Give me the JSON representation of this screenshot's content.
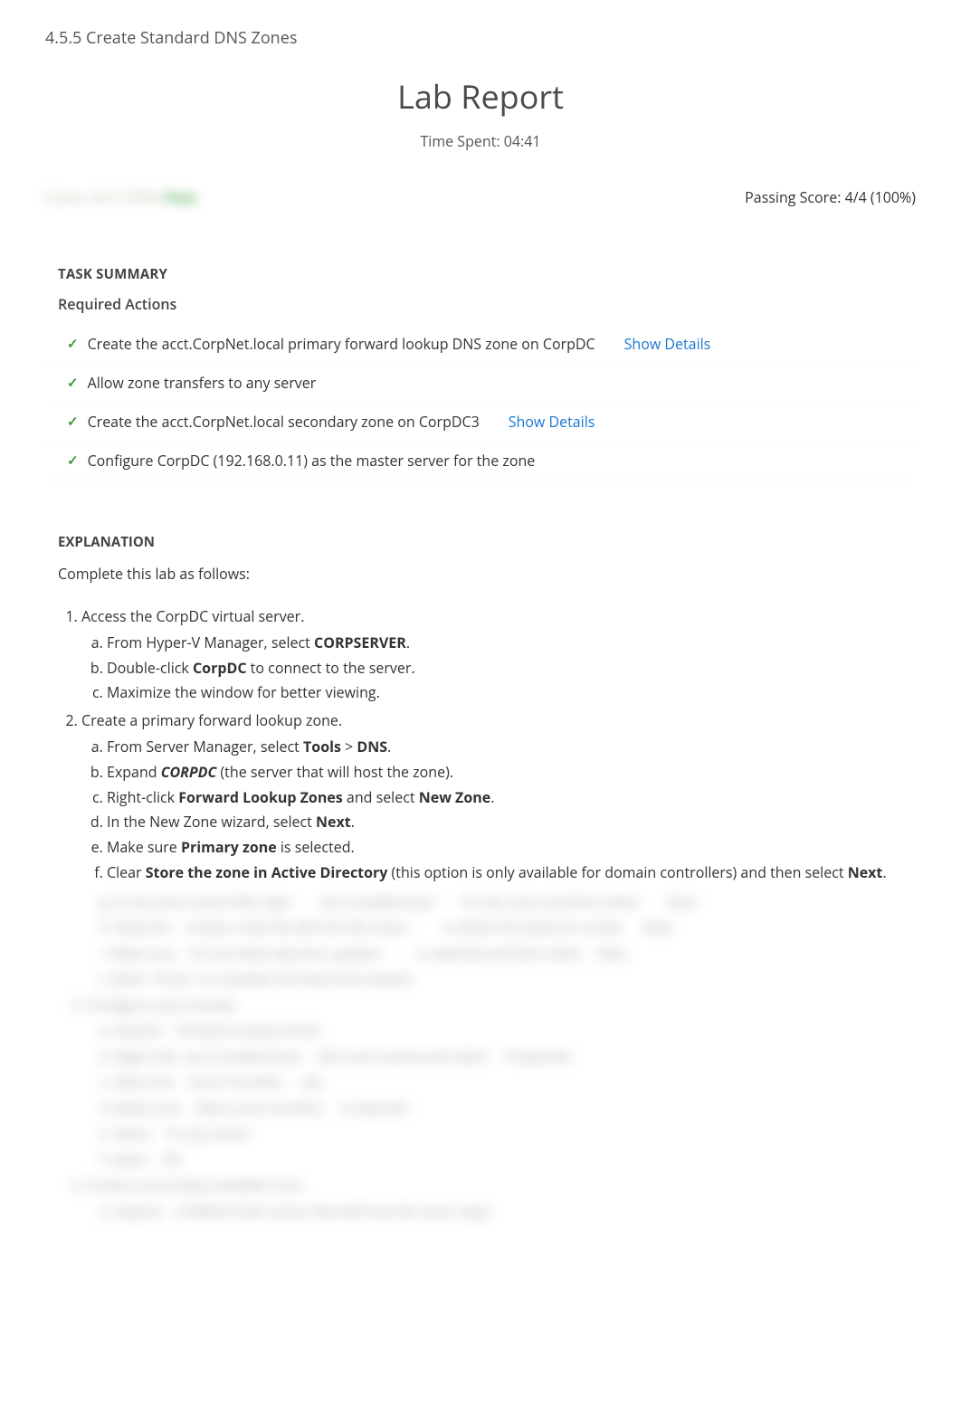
{
  "breadcrumb": "4.5.5 Create Standard DNS Zones",
  "report": {
    "title": "Lab Report",
    "time_spent_label": "Time Spent: 04:41",
    "score_left": "Score: 4/4 (100%) ",
    "score_left_status": "Pass",
    "passing_score": "Passing Score: 4/4 (100%)"
  },
  "task_summary": {
    "header": "TASK SUMMARY",
    "required_header": "Required Actions",
    "items": [
      {
        "text": "Create the acct.CorpNet.local primary forward lookup DNS zone on CorpDC",
        "details": "Show Details"
      },
      {
        "text": "Allow zone transfers to any server",
        "details": ""
      },
      {
        "text": "Create the acct.CorpNet.local secondary zone on CorpDC3",
        "details": "Show Details"
      },
      {
        "text": "Configure CorpDC (192.168.0.11) as the master server for the zone",
        "details": ""
      }
    ]
  },
  "explanation": {
    "header": "EXPLANATION",
    "intro": "Complete this lab as follows:",
    "step1": {
      "title": "Access the CorpDC virtual server.",
      "a_pre": "From Hyper-V Manager, select ",
      "a_bold": "CORPSERVER",
      "a_post": ".",
      "b_pre": "Double-click ",
      "b_bold": "CorpDC",
      "b_post": " to connect to the server.",
      "c": "Maximize the window for better viewing."
    },
    "step2": {
      "title": "Create a primary forward lookup zone.",
      "a_pre": "From Server Manager, select ",
      "a_b1": "Tools",
      "a_mid": " > ",
      "a_b2": "DNS",
      "a_post": ".",
      "b_pre": "Expand ",
      "b_bold": "CORPDC",
      "b_post": " (the server that will host the zone).",
      "c_pre": "Right-click ",
      "c_b1": "Forward Lookup Zones",
      "c_mid": " and select ",
      "c_b2": "New Zone",
      "c_post": ".",
      "d_pre": "In the New Zone wizard, select ",
      "d_bold": "Next",
      "d_post": ".",
      "e_pre": "Make sure ",
      "e_bold": "Primary zone",
      "e_post": " is selected.",
      "f_pre": "Clear ",
      "f_bold": "Store the zone in Active Directory",
      "f_mid": " (this option is only available for domain controllers) and then select ",
      "f_b2": "Next",
      "f_post": "."
    }
  },
  "blurred": {
    "l1": "g. In the Zone name field, type        acct.CorpNet.local        for the zone and then select        Next",
    "l2": "h. Keep the    Create a new file with the file name          to allow the wizard to create      Next",
    "l3": "i. Make sure    Do not allow dynamic updates          is selected and then select    Next",
    "l4": "j. Select  Finish  to complete the New Zone wizard.",
    "l5": "3. Configure zone transfer",
    "l6": "a. Expand    Forward Lookup Zones",
    "l7": "b. Right-click  acct.CorpNet.local     (the zone name) and select     Properties",
    "l8": "c. Select the    Zone Transfers     tab",
    "l9": "d. Make sure    Allow zone transfers     is selected",
    "l10": "e. Select    To any server",
    "l11": "f. Select    OK",
    "l12": "4. Create a secondary available zone",
    "l13": "a. Expand    CORPDC3 (the server that will host the zone copy)"
  }
}
